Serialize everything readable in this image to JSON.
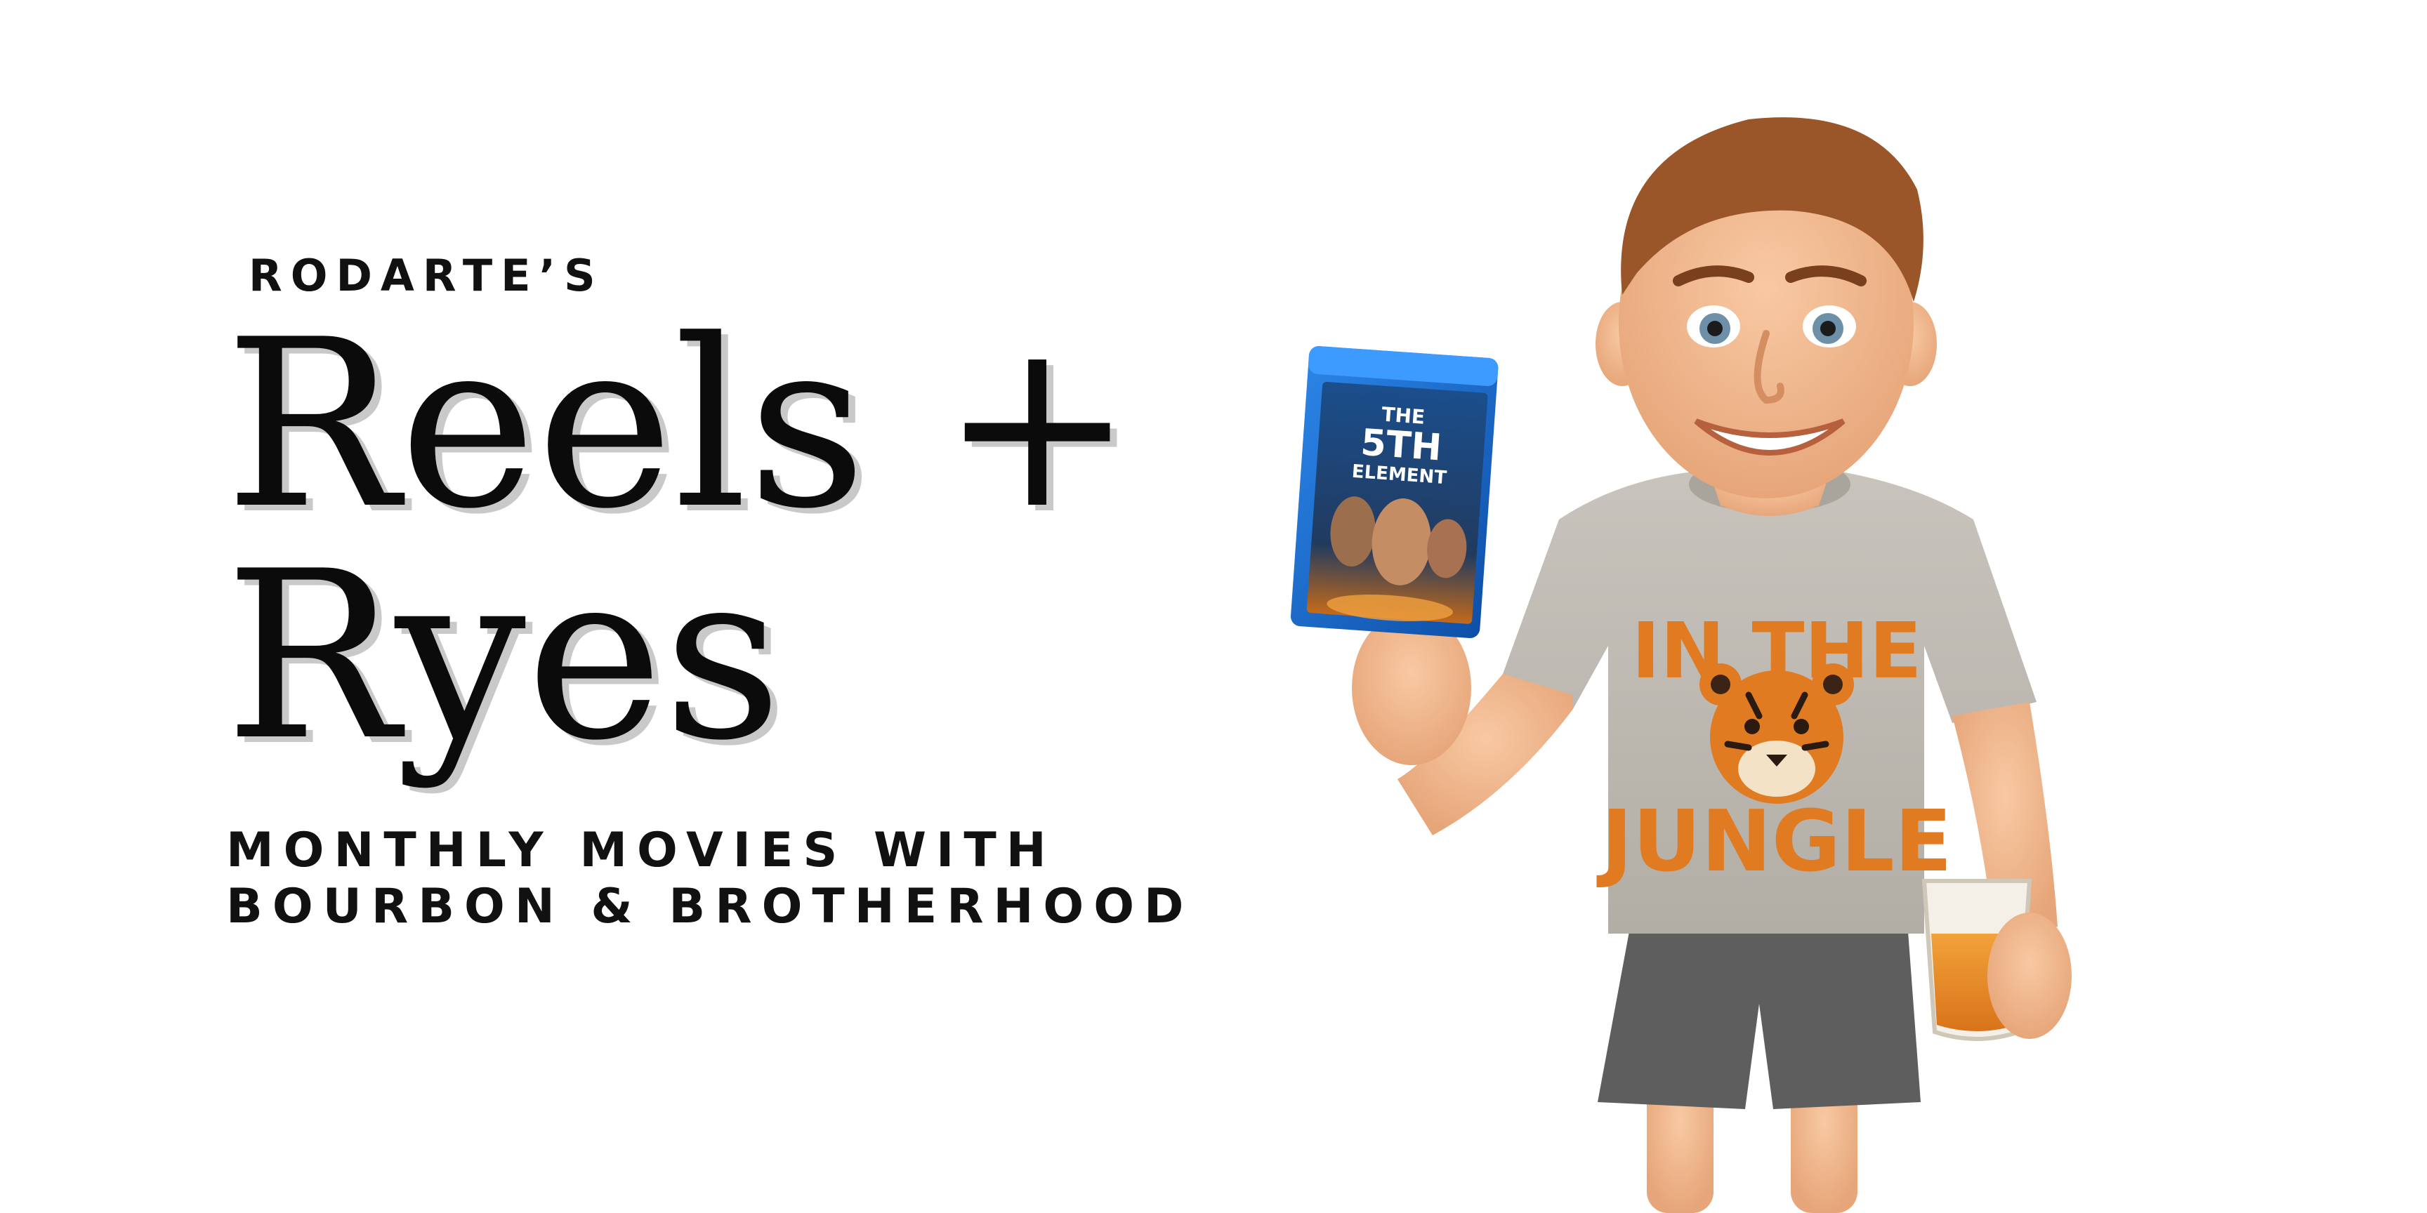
{
  "header": {
    "eyebrow": "RODARTE’S",
    "title_line1": "Reels +",
    "title_line2": "Ryes"
  },
  "tagline": {
    "line1": "MONTHLY MOVIES WITH",
    "line2": "BOURBON & BROTHERHOOD"
  },
  "illustration": {
    "bluray": {
      "title_line1": "THE",
      "title_line2": "5TH",
      "title_line3": "ELEMENT"
    },
    "shirt": {
      "top_text": "IN THE",
      "bottom_text": "JUNGLE"
    }
  },
  "colors": {
    "background": "#ffffff",
    "text": "#0b0b0b",
    "headline_shadow": "#c9c9c9",
    "bluray_blue": "#1e6fd0",
    "shirt_gray": "#bdb9b1",
    "shirt_orange": "#e07b22",
    "shorts_gray": "#5e5e5e",
    "skin": "#f2b78c",
    "hair": "#9a5528",
    "drink": "#e58a1f"
  }
}
